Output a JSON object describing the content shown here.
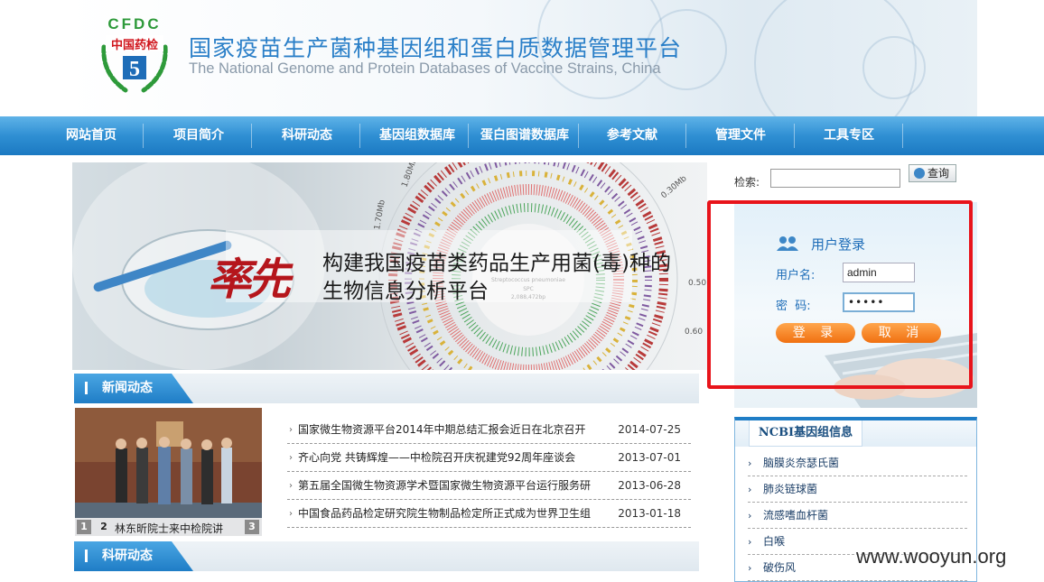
{
  "header": {
    "logo_text": "CFDC",
    "logo_badge": "中国药检",
    "title": "国家疫苗生产菌种基因组和蛋白质数据管理平台",
    "subtitle": "The National Genome and Protein Databases of Vaccine Strains, China"
  },
  "nav": {
    "items": [
      {
        "label": "网站首页"
      },
      {
        "label": "项目简介"
      },
      {
        "label": "科研动态"
      },
      {
        "label": "基因组数据库"
      },
      {
        "label": "蛋白图谱数据库"
      },
      {
        "label": "参考文献"
      },
      {
        "label": "管理文件"
      },
      {
        "label": "工具专区"
      }
    ]
  },
  "banner": {
    "highlight": "率先",
    "line1": "构建我国疫苗类药品生产用菌(毒)种的",
    "line2": "生物信息分析平台"
  },
  "search": {
    "label": "检索:",
    "value": "",
    "button": "查询"
  },
  "login": {
    "title": "用户登录",
    "username_label": "用户名:",
    "username_value": "admin",
    "password_label": "密  码:",
    "password_value": "•••••",
    "login_button": "登 录",
    "cancel_button": "取 消"
  },
  "news": {
    "section_title": "新闻动态",
    "photo_caption": "林东昕院士来中检院讲",
    "photo_pages": [
      "1",
      "2",
      "3"
    ],
    "items": [
      {
        "title": "国家微生物资源平台2014年中期总结汇报会近日在北京召开",
        "date": "2014-07-25"
      },
      {
        "title": "齐心向党 共铸辉煌——中检院召开庆祝建党92周年座谈会",
        "date": "2013-07-01"
      },
      {
        "title": "第五届全国微生物资源学术暨国家微生物资源平台运行服务研",
        "date": "2013-06-28"
      },
      {
        "title": "中国食品药品检定研究院生物制品检定所正式成为世界卫生组",
        "date": "2013-01-18"
      }
    ]
  },
  "research": {
    "section_title": "科研动态"
  },
  "ncbi": {
    "title": "NCBI基因组信息",
    "items": [
      {
        "label": "脑膜炎奈瑟氏菌"
      },
      {
        "label": "肺炎链球菌"
      },
      {
        "label": "流感嗜血杆菌"
      },
      {
        "label": "白喉"
      },
      {
        "label": "破伤风"
      }
    ]
  },
  "watermark": "www.wooyun.org",
  "colors": {
    "nav_blue": "#2f8fd3",
    "title_blue": "#2a7fc8",
    "login_orange": "#f07010",
    "highlight_red": "#e8141b"
  }
}
